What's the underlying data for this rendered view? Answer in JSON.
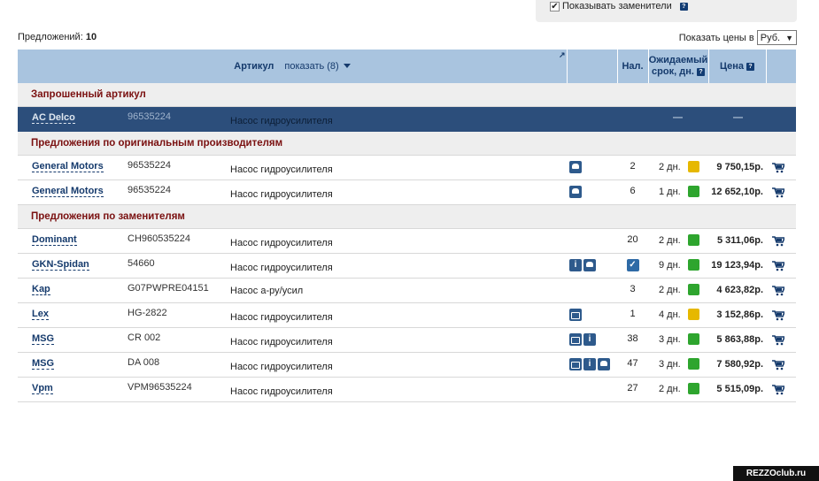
{
  "top_panel": {
    "show_substitutes_label": "Показывать заменители",
    "help": "?"
  },
  "offers": {
    "label": "Предложений:",
    "count": "10"
  },
  "prices": {
    "label": "Показать цены в",
    "currency": "Руб.",
    "arrow": "▼"
  },
  "header": {
    "article": "Артикул",
    "show": "показать (8)",
    "stock": "Нал.",
    "expected_line1": "Ожидаемый",
    "expected_line2": "срок, дн.",
    "price": "Цена",
    "help": "?",
    "corner": "↗"
  },
  "sections": {
    "requested": "Запрошенный артикул",
    "original": "Предложения по оригинальным производителям",
    "substitutes": "Предложения по заменителям"
  },
  "requested_row": {
    "brand": "AC Delco",
    "article": "96535224",
    "descr": "Насос гидроусилителя",
    "qty": "—",
    "price": "—"
  },
  "original_rows": [
    {
      "brand": "General Motors",
      "article": "96535224",
      "descr": "Насос гидроусилителя",
      "qty": "2",
      "days": "2 дн.",
      "status": "yellow",
      "price": "9 750,15р."
    },
    {
      "brand": "General Motors",
      "article": "96535224",
      "descr": "Насос гидроусилителя",
      "qty": "6",
      "days": "1 дн.",
      "status": "green",
      "price": "12 652,10р."
    }
  ],
  "substitute_rows": [
    {
      "brand": "Dominant",
      "article": "CH960535224",
      "descr": "Насос гидроусилителя",
      "qty": "20",
      "days": "2 дн.",
      "status": "green",
      "price": "5 311,06р."
    },
    {
      "brand": "GKN-Spidan",
      "article": "54660",
      "descr": "Насос гидроусилителя",
      "qty": "",
      "days": "9 дн.",
      "status": "green",
      "price": "19 123,94р."
    },
    {
      "brand": "Kap",
      "article": "G07PWPRE04151",
      "descr": "Насос а-ру/усил",
      "qty": "3",
      "days": "2 дн.",
      "status": "green",
      "price": "4 623,82р."
    },
    {
      "brand": "Lex",
      "article": "HG-2822",
      "descr": "Насос гидроусилителя",
      "qty": "1",
      "days": "4 дн.",
      "status": "yellow",
      "price": "3 152,86р."
    },
    {
      "brand": "MSG",
      "article": "CR 002",
      "descr": "Насос гидроусилителя",
      "qty": "38",
      "days": "3 дн.",
      "status": "green",
      "price": "5 863,88р."
    },
    {
      "brand": "MSG",
      "article": "DA 008",
      "descr": "Насос гидроусилителя",
      "qty": "47",
      "days": "3 дн.",
      "status": "green",
      "price": "7 580,92р."
    },
    {
      "brand": "Vpm",
      "article": "VPM96535224",
      "descr": "Насос гидроусилителя",
      "qty": "27",
      "days": "2 дн.",
      "status": "green",
      "price": "5 515,09р."
    }
  ],
  "colors": {
    "header_bg": "#a9c4df",
    "selected_row": "#2c4e7b",
    "section_text": "#7a1010",
    "status_green": "#2ea52e",
    "status_yellow": "#e6b800"
  },
  "icon_names": [
    "car-icon",
    "info-icon",
    "package-icon",
    "check-icon",
    "cart-icon"
  ],
  "watermark": "REZZOclub.ru"
}
